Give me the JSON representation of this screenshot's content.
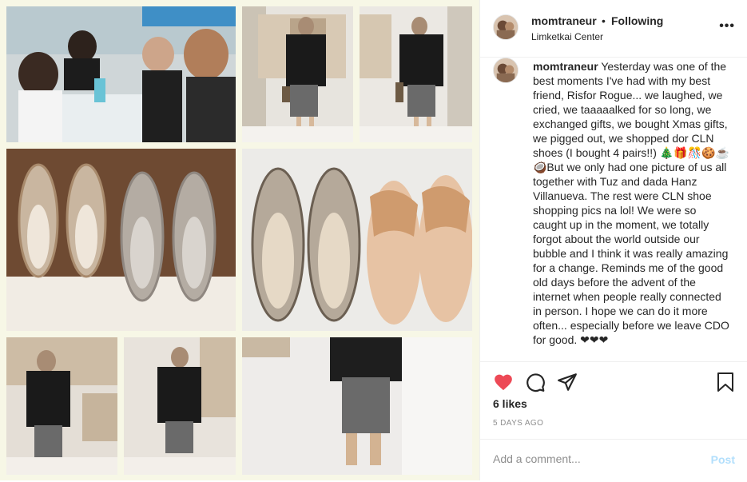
{
  "header": {
    "username": "momtraneur",
    "separator": "•",
    "follow_label": "Following",
    "location": "Limketkai Center",
    "more_label": "•••"
  },
  "caption": {
    "username": "momtraneur",
    "text": "Yesterday was one of the best moments I've had with my best friend, Risfor Rogue... we laughed, we cried, we taaaaalked for so long, we exchanged gifts, we bought Xmas gifts, we pigged out, we shopped dor CLN shoes (I bought 4 pairs!!) 🎄🎁🎊🍪☕🥥But we only had one picture of us all together with Tuz and dada Hanz Villanueva. The rest were CLN shoe shopping pics na lol! We were so caught up in the moment, we totally forgot about the world outside our bubble and I think it was really amazing for a change. Reminds me of the good old days before the advent of the internet when people really connected in person. I hope we can do it more often... especially before we leave CDO for good. ❤❤❤"
  },
  "actions": {
    "like_icon": "heart-filled",
    "comment_icon": "speech-bubble",
    "share_icon": "paper-plane",
    "save_icon": "bookmark",
    "like_color": "#ed4956"
  },
  "likes": "6 likes",
  "date": "5 DAYS AGO",
  "add_comment": {
    "placeholder": "Add a comment...",
    "post_label": "Post"
  }
}
